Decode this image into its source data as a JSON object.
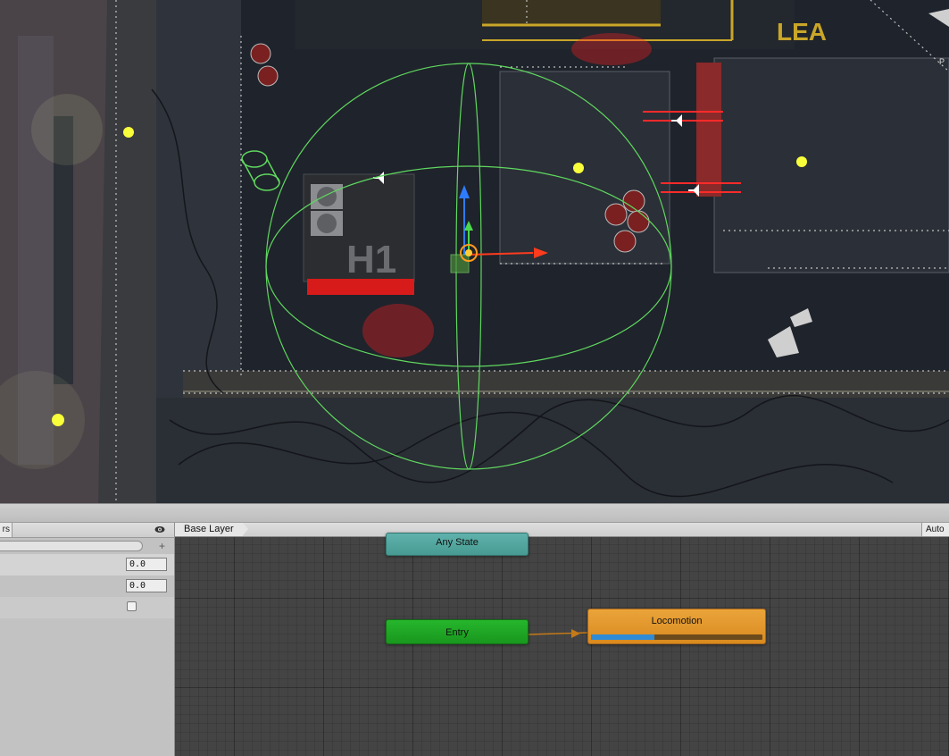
{
  "scene": {
    "sign_text": "H1",
    "corner_text": "LEA",
    "edge_text": "P"
  },
  "parameters_panel": {
    "tab_label": "rs",
    "rows": [
      {
        "type": "float",
        "value": "0.0"
      },
      {
        "type": "float",
        "value": "0.0"
      },
      {
        "type": "bool",
        "checked": false
      }
    ]
  },
  "animator": {
    "breadcrumb": "Base Layer",
    "auto_label": "Auto",
    "nodes": {
      "any_state": "Any State",
      "entry": "Entry",
      "locomotion": "Locomotion"
    },
    "locomotion_progress": 0.37
  },
  "colors": {
    "any_state": "#54a79f",
    "entry": "#21a826",
    "locomotion": "#e0962c",
    "progress": "#2f8bd5",
    "gizmo_green": "#5fd85f"
  }
}
